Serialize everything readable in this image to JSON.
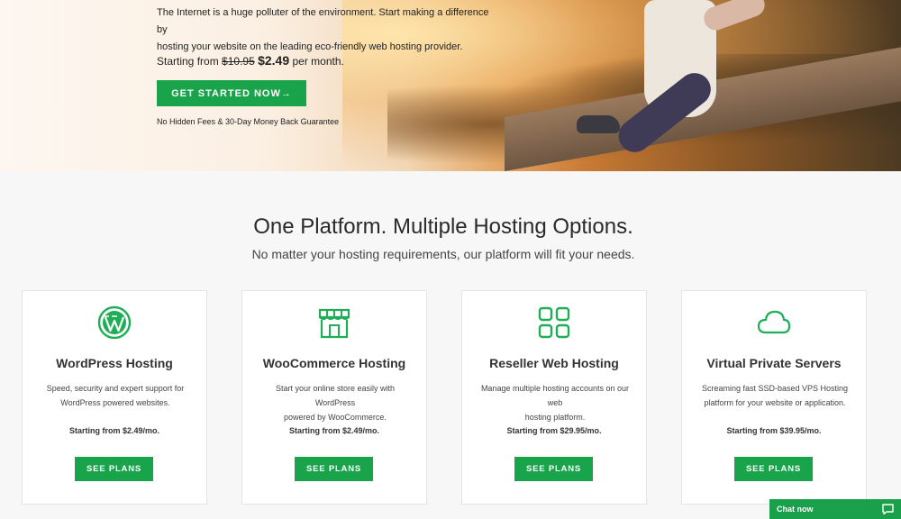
{
  "hero": {
    "line1": "The Internet is a huge polluter of the environment. Start making a difference by",
    "line2": "hosting your website on the leading eco-friendly web hosting provider.",
    "price_prefix": "Starting from",
    "old_price": "$10.95",
    "new_price": "$2.49",
    "price_suffix": "per month.",
    "cta_label": "GET STARTED NOW→",
    "guarantee": "No Hidden Fees & 30-Day Money Back Guarantee"
  },
  "section": {
    "title": "One Platform. Multiple Hosting Options.",
    "subtitle": "No matter your hosting requirements, our platform will fit your needs."
  },
  "cards": [
    {
      "icon": "wordpress-icon",
      "title": "WordPress Hosting",
      "desc1": "Speed, security and expert support for",
      "desc2": "WordPress powered websites.",
      "price": "Starting from $2.49/mo.",
      "button": "SEE PLANS"
    },
    {
      "icon": "store-icon",
      "title": "WooCommerce Hosting",
      "desc1": "Start your online store easily with WordPress",
      "desc2": "powered by WooCommerce.",
      "price": "Starting from $2.49/mo.",
      "button": "SEE PLANS"
    },
    {
      "icon": "grid-icon",
      "title": "Reseller Web Hosting",
      "desc1": "Manage multiple hosting accounts on our web",
      "desc2": "hosting platform.",
      "price": "Starting from $29.95/mo.",
      "button": "SEE PLANS"
    },
    {
      "icon": "cloud-icon",
      "title": "Virtual Private Servers",
      "desc1": "Screaming fast SSD-based VPS Hosting",
      "desc2": "platform for your website or application.",
      "price": "Starting from $39.95/mo.",
      "button": "SEE PLANS"
    }
  ],
  "chat": {
    "label": "Chat now",
    "icon": "chat-bubble-icon"
  },
  "colors": {
    "accent": "#19a34a",
    "icon_green": "#1fae57"
  }
}
